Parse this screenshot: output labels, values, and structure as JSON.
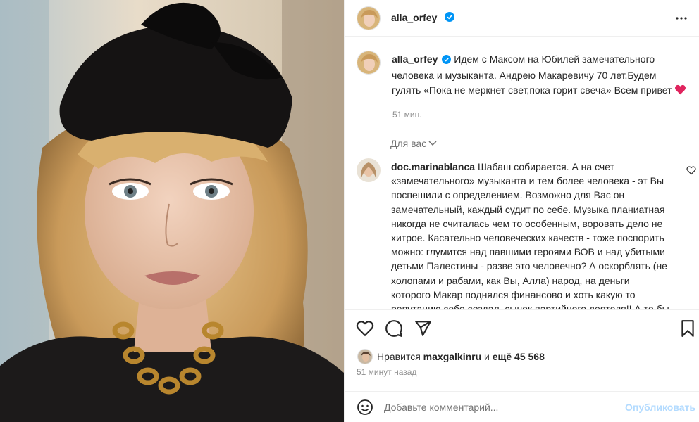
{
  "post": {
    "username": "alla_orfey",
    "caption_text": "Идем с Максом на Юбилей замечательного человека и музыканта. Андрею Макаревичу 70 лет.Будем гулять «Пока не меркнет свет,пока горит свеча» Всем привет",
    "caption_time": "51 мин.",
    "for_you_label": "Для вас"
  },
  "comment": {
    "username": "doc.marinablanca",
    "text": "Шабаш собирается. А на счет «замечательного» музыканта и тем более человека - эт Вы поспешили с определением. Возможно для Вас он замечательный, каждый судит по себе. Музыка планиатная никогда не считалась чем то особенным, воровать дело не хитрое. Касательно человеческих качеств - тоже поспорить можно: глумится над павшими героями ВОВ и над убитыми детьми Палестины - разве это человечно? А оскорблять (не холопами и рабами, как Вы, Алла) народ, на деньги которого Макар поднялся финансово и хоть какую то репутацию себе создал, сынок партийного деятеля!! А то бы"
  },
  "likes": {
    "prefix": "Нравится",
    "liker": "maxgalkinru",
    "conj": "и",
    "rest": "ещё 45 568"
  },
  "post_time": "51 минут назад",
  "add_comment": {
    "placeholder": "Добавьте комментарий...",
    "publish_label": "Опубликовать"
  },
  "icons": {
    "more": "more-horizontal-icon",
    "verified": "verified-badge-icon",
    "like": "heart-icon",
    "comment": "comment-icon",
    "share": "send-icon",
    "save": "bookmark-icon",
    "emoji": "emoji-smile-icon",
    "chevron": "chevron-down-icon"
  },
  "colors": {
    "verified_blue": "#0095f6",
    "heart_red": "#e0245e",
    "publish_disabled": "#b3dbff",
    "muted_text": "#8e8e8e"
  }
}
